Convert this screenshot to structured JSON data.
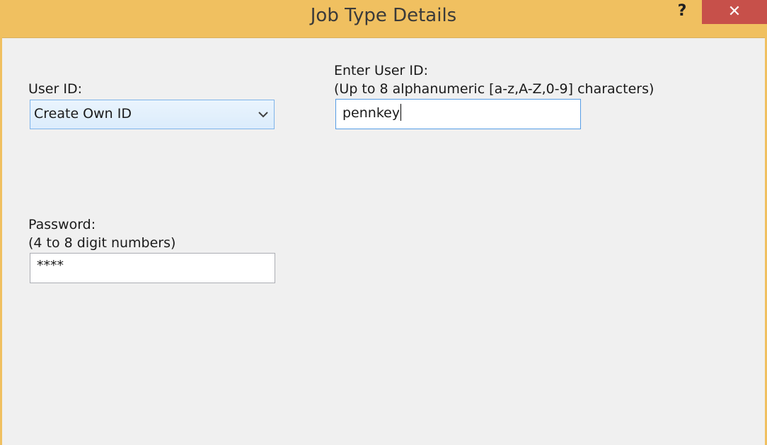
{
  "window": {
    "title": "Job Type Details",
    "help_label": "?",
    "close_label": "✕"
  },
  "user_id": {
    "label": "User ID:",
    "selected_value": "Create Own ID",
    "chevron_icon": "chevron-down-icon"
  },
  "enter_user_id": {
    "label": "Enter User ID:",
    "hint": "(Up to 8 alphanumeric [a-z,A-Z,0-9] characters)",
    "value": "pennkey"
  },
  "password": {
    "label": "Password:",
    "hint": "(4 to 8 digit numbers)",
    "value": "****"
  },
  "colors": {
    "titlebar": "#f0c060",
    "close_button": "#c7504a",
    "client_background": "#f0f0f0",
    "focus_border": "#569de5"
  }
}
